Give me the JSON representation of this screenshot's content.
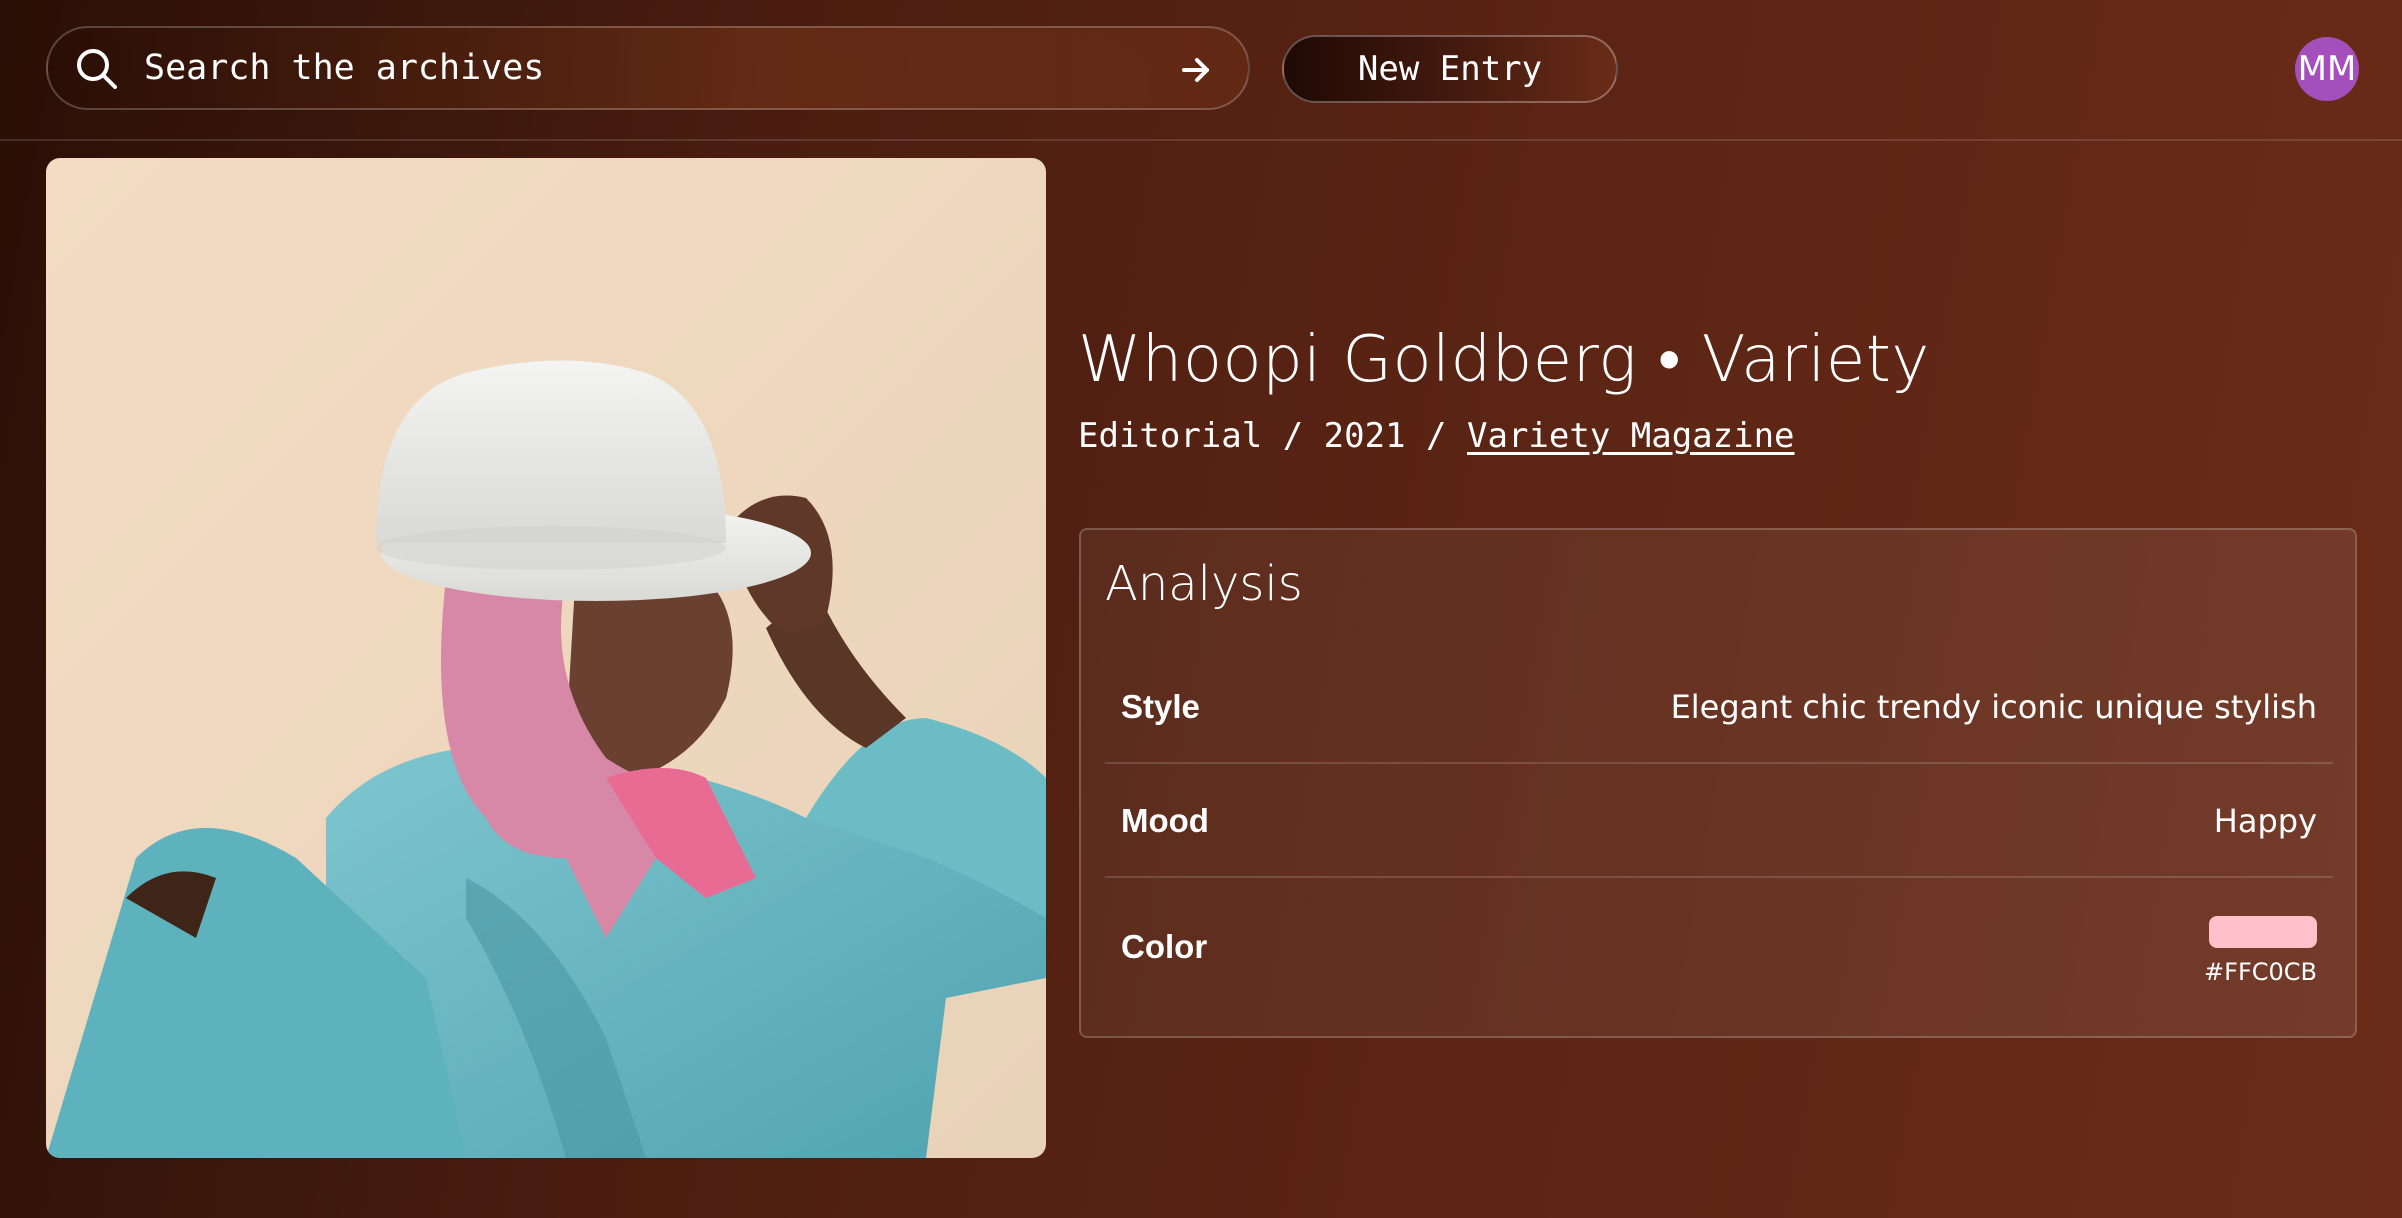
{
  "search": {
    "placeholder": "Search the archives",
    "icon": "search-icon",
    "submit_icon": "arrow-right-icon"
  },
  "toolbar": {
    "new_entry_label": "New Entry"
  },
  "user": {
    "initials": "MM",
    "avatar_color": "#A44FBB"
  },
  "entry": {
    "title": "Whoopi Goldberg • Variety",
    "category": "Editorial",
    "year": "2021",
    "publication": "Variety Magazine",
    "image": "portrait-photo"
  },
  "analysis": {
    "heading": "Analysis",
    "style_label": "Style",
    "style_value": "Elegant chic trendy iconic unique stylish",
    "mood_label": "Mood",
    "mood_value": "Happy",
    "color_label": "Color",
    "color_value": "#FFC0CB"
  },
  "colors": {
    "background": "#4A1D10",
    "accent_swatch": "#FFC0CB",
    "avatar": "#A44FBB"
  }
}
